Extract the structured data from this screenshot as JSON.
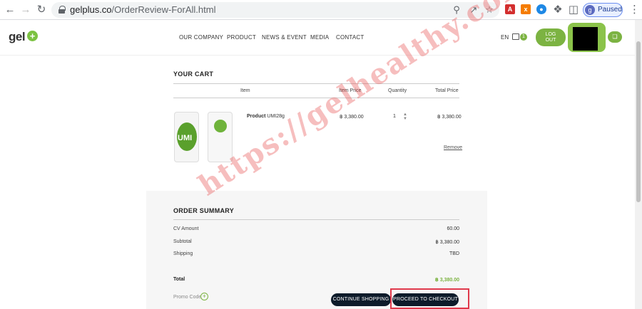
{
  "browser": {
    "url_host": "gelplus.co",
    "url_path": "/OrderReview-ForAll.html",
    "profile_initial": "g",
    "profile_status": "Paused"
  },
  "site": {
    "logo_text": "gel",
    "nav": [
      "OUR COMPANY",
      "PRODUCT",
      "NEWS & EVENT",
      "MEDIA",
      "CONTACT"
    ],
    "lang": "EN",
    "cart_count": "1",
    "logout_label_1": "LOG",
    "logout_label_2": "OUT"
  },
  "cart": {
    "title": "YOUR CART",
    "columns": [
      "Item",
      "Item Price",
      "Quantity",
      "Total Price"
    ],
    "item": {
      "label_bold": "Product",
      "label": "UMI28g",
      "price": "฿ 3,380.00",
      "quantity": "1",
      "total": "฿ 3,380.00",
      "image_text": "UMI"
    },
    "remove_label": "Remove"
  },
  "summary": {
    "title": "ORDER SUMMARY",
    "rows": [
      {
        "label": "CV Amount",
        "value": "60.00"
      },
      {
        "label": "Subtotal",
        "value": "฿ 3,380.00"
      },
      {
        "label": "Shipping",
        "value": "TBD"
      }
    ],
    "total_label": "Total",
    "total_value": "฿ 3,380.00",
    "promo_label": "Promo Code",
    "continue_label": "CONTINUE SHOPPING",
    "checkout_label": "PROCEED TO CHECKOUT"
  },
  "watermark": "https://gelhealthy.com",
  "colors": {
    "brand_green": "#7cb342",
    "button_dark": "#0d1b2a",
    "highlight_red": "#e0394b"
  }
}
